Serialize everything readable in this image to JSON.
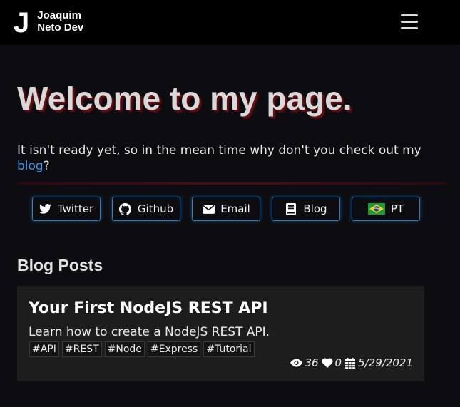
{
  "header": {
    "logo_mark": "J",
    "name_line1": "Joaquim",
    "name_line2": "Neto Dev",
    "menu_icon": "hamburger-menu-icon"
  },
  "hero": {
    "title": "Welcome to my page.",
    "intro_before": "It isn't ready yet, so in the mean time why don't you check out my ",
    "intro_link": "blog",
    "intro_after": "?"
  },
  "socials": [
    {
      "label": "Twitter",
      "icon": "twitter-icon"
    },
    {
      "label": "Github",
      "icon": "github-icon"
    },
    {
      "label": "Email",
      "icon": "envelope-icon"
    },
    {
      "label": "Blog",
      "icon": "book-icon"
    },
    {
      "label": "PT",
      "icon": "brazil-flag-icon"
    }
  ],
  "blog": {
    "section_title": "Blog Posts",
    "posts": [
      {
        "title": "Your First NodeJS REST API",
        "description": "Learn how to create a NodeJS REST API.",
        "tags": [
          "#API",
          "#REST",
          "#Node",
          "#Express",
          "#Tutorial"
        ],
        "views": "36",
        "likes": "0",
        "date": "5/29/2021"
      }
    ]
  },
  "colors": {
    "accent_link": "#3b9ce8",
    "button_border": "#2b7fbf",
    "title_shadow": "#6a0f12",
    "background": "#0d0c11",
    "card_background": "#1d1d1d"
  }
}
